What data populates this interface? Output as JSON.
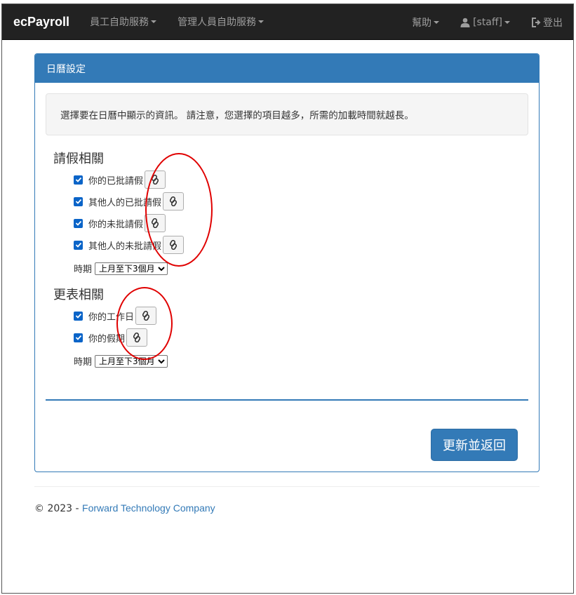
{
  "navbar": {
    "brand": "ecPayroll",
    "menus": [
      {
        "label": "員工自助服務"
      },
      {
        "label": "管理人員自助服務"
      }
    ],
    "help": "幫助",
    "user": "[staff]",
    "logout": "登出"
  },
  "panel": {
    "heading": "日曆設定",
    "notice": "選擇要在日曆中顯示的資訊。 請注意，您選擇的項目越多，所需的加載時間就越長。",
    "leave": {
      "title": "請假相關",
      "options": [
        {
          "label": "你的已批請假",
          "checked": true
        },
        {
          "label": "其他人的已批請假",
          "checked": true
        },
        {
          "label": "你的未批請假",
          "checked": true
        },
        {
          "label": "其他人的未批請假",
          "checked": true
        }
      ],
      "period_label": "時期",
      "period_value": "上月至下3個月"
    },
    "roster": {
      "title": "更表相關",
      "options": [
        {
          "label": "你的工作日",
          "checked": true
        },
        {
          "label": "你的假期",
          "checked": true
        }
      ],
      "period_label": "時期",
      "period_value": "上月至下3個月"
    },
    "submit": "更新並返回"
  },
  "footer": {
    "prefix": "© 2023 - ",
    "company": "Forward Technology Company"
  },
  "colors": {
    "navbar": "#222222",
    "primary": "#337ab7",
    "checkbox": "#0a64c8",
    "annotation": "#e00000"
  },
  "icons": [
    "chevron-down-icon",
    "user-icon",
    "logout-icon",
    "link-icon",
    "check-icon"
  ]
}
